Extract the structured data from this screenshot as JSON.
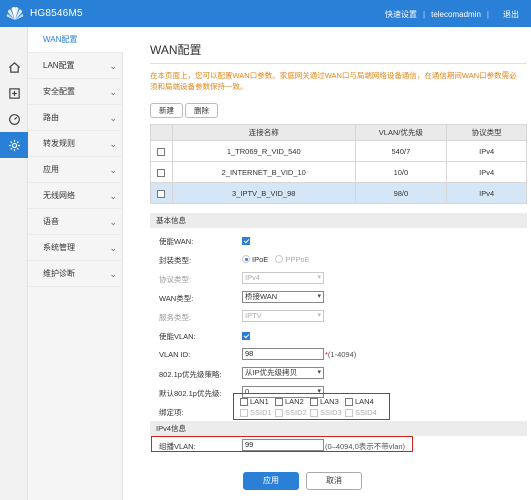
{
  "header": {
    "brand": "HG8546M5",
    "quick_setup": "快速设置",
    "user": "telecomadmin",
    "exit": "退出"
  },
  "icon_nav": [
    {
      "icon": "home-icon",
      "active": false
    },
    {
      "icon": "add-box-icon",
      "active": false
    },
    {
      "icon": "gauge-icon",
      "active": false
    },
    {
      "icon": "gear-icon",
      "active": true
    }
  ],
  "sidebar": {
    "current": "WAN配置",
    "items": [
      {
        "label": "LAN配置"
      },
      {
        "label": "安全配置"
      },
      {
        "label": "路由"
      },
      {
        "label": "转发规则"
      },
      {
        "label": "应用"
      },
      {
        "label": "无线网络"
      },
      {
        "label": "语音"
      },
      {
        "label": "系统管理"
      },
      {
        "label": "维护诊断"
      }
    ]
  },
  "main": {
    "title": "WAN配置",
    "notice": "在本页面上，您可以配置WAN口参数。家庭网关通过WAN口与局端网络设备通信，在通信期间WAN口参数需必须和局端设备参数保持一致。",
    "new_button": "新建",
    "delete_button": "删除",
    "table": {
      "headers": [
        "连接名称",
        "VLAN/优先级",
        "协议类型"
      ],
      "rows": [
        {
          "name": "1_TR069_R_VID_540",
          "vlan": "540/7",
          "proto": "IPv4",
          "selected": false
        },
        {
          "name": "2_INTERNET_B_VID_10",
          "vlan": "10/0",
          "proto": "IPv4",
          "selected": false
        },
        {
          "name": "3_IPTV_B_VID_98",
          "vlan": "98/0",
          "proto": "IPv4",
          "selected": true
        }
      ]
    },
    "basic": {
      "header": "基本信息",
      "enable_wan_label": "使能WAN:",
      "encap_label": "封装类型:",
      "encap_ipoe": "IPoE",
      "encap_pppoe": "PPPoE",
      "protocol_label": "协议类型:",
      "protocol_value": "IPv4",
      "wan_type_label": "WAN类型:",
      "wan_type_value": "桥接WAN",
      "service_label": "服务类型:",
      "service_value": "IPTV",
      "enable_vlan_label": "使能VLAN:",
      "vlan_id_label": "VLAN ID:",
      "vlan_id_value": "98",
      "vlan_id_req": "*",
      "vlan_id_hint": "(1-4094)",
      "policy_label": "802.1p优先级策略:",
      "policy_value": "从IP优先级拷贝",
      "default_prio_label": "默认802.1p优先级:",
      "default_prio_value": "0",
      "bind_label": "绑定项:",
      "bind_options": [
        {
          "label": "LAN1",
          "disabled": false
        },
        {
          "label": "LAN2",
          "disabled": false
        },
        {
          "label": "LAN3",
          "disabled": false
        },
        {
          "label": "LAN4",
          "disabled": false
        },
        {
          "label": "SSID1",
          "disabled": true
        },
        {
          "label": "SSID2",
          "disabled": true
        },
        {
          "label": "SSID3",
          "disabled": true
        },
        {
          "label": "SSID4",
          "disabled": true
        }
      ]
    },
    "ipv4": {
      "header": "IPv4信息",
      "multicast_label": "组播VLAN:",
      "multicast_value": "99",
      "multicast_hint": "(0–4094,0表示不带vlan)"
    },
    "apply_button": "应用",
    "cancel_button": "取消"
  }
}
